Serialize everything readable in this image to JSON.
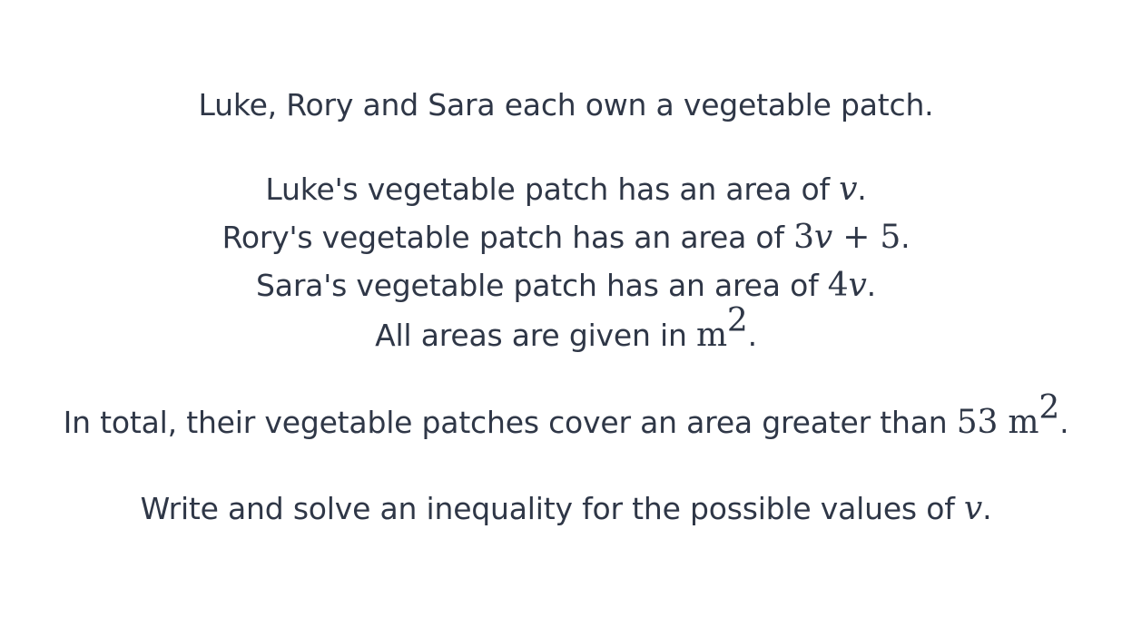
{
  "intro": "Luke, Rory and Sara each own a vegetable patch.",
  "luke": {
    "text": "Luke's vegetable patch has an area of ",
    "math": "v",
    "end": "."
  },
  "rory": {
    "text": "Rory's vegetable patch has an area of ",
    "math_coef": "3",
    "math_var": "v",
    "math_rest": " + 5",
    "end": "."
  },
  "sara": {
    "text": "Sara's vegetable patch has an area of ",
    "math_coef": "4",
    "math_var": "v",
    "end": "."
  },
  "units": {
    "text": "All areas are given in ",
    "unit": "m",
    "power": "2",
    "end": "."
  },
  "total": {
    "text": "In total, their vegetable patches cover an area greater than ",
    "value": "53",
    "unit": " m",
    "power": "2",
    "end": "."
  },
  "task": {
    "text": "Write and solve an inequality for the possible values of ",
    "math": "v",
    "end": "."
  }
}
